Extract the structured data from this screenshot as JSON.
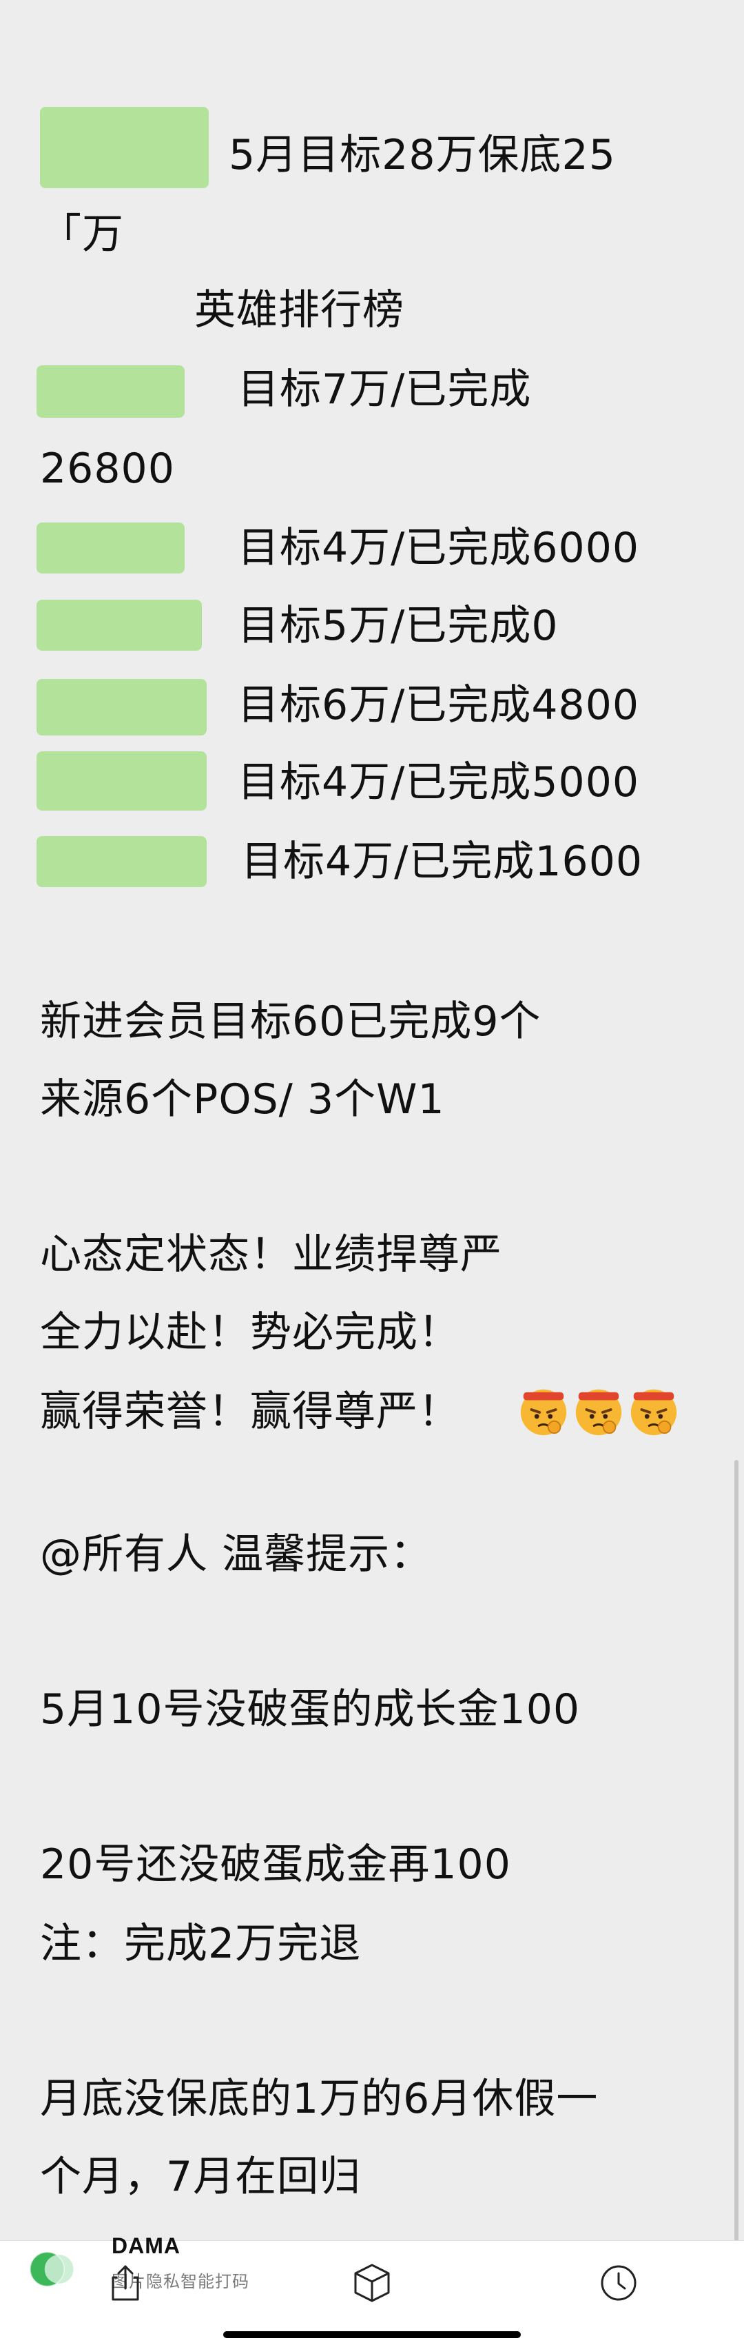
{
  "message": {
    "line1_text": "5月目标28万保底25",
    "line2_text": "「万",
    "ranking_title": "英雄排行榜",
    "rows": [
      {
        "text": "目标7万/已完成"
      },
      {
        "text": "26800"
      },
      {
        "text": "目标4万/已完成6000"
      },
      {
        "text": "目标5万/已完成0"
      },
      {
        "text": "目标6万/已完成4800"
      },
      {
        "text": "目标4万/已完成5000"
      },
      {
        "text": "目标4万/已完成1600"
      }
    ],
    "members_line1": "新进会员目标60已完成9个",
    "members_line2": "来源6个POS/ 3个W1",
    "motto_line1": "心态定状态！业绩捍尊严",
    "motto_line2": "全力以赴！势必完成！",
    "motto_line3": "赢得荣誉！赢得尊严！",
    "emoji_name": "determined-face-emoji",
    "notice_title": "@所有人 温馨提示：",
    "notice_line1": "5月10号没破蛋的成长金100",
    "notice_line2": "20号还没破蛋成金再100",
    "notice_line3": "注：完成2万完退",
    "notice_line4": "月底没保底的1万的6月休假一",
    "notice_line5": "个月，7月在回归"
  },
  "colors": {
    "background": "#ededed",
    "redaction": "#b3e39b",
    "text": "#111111"
  },
  "watermark": {
    "title": "DAMA",
    "subtitle": "图片隐私智能打码"
  },
  "bottom_nav": {
    "icons": [
      "share-icon",
      "box-icon",
      "clock-icon"
    ]
  }
}
